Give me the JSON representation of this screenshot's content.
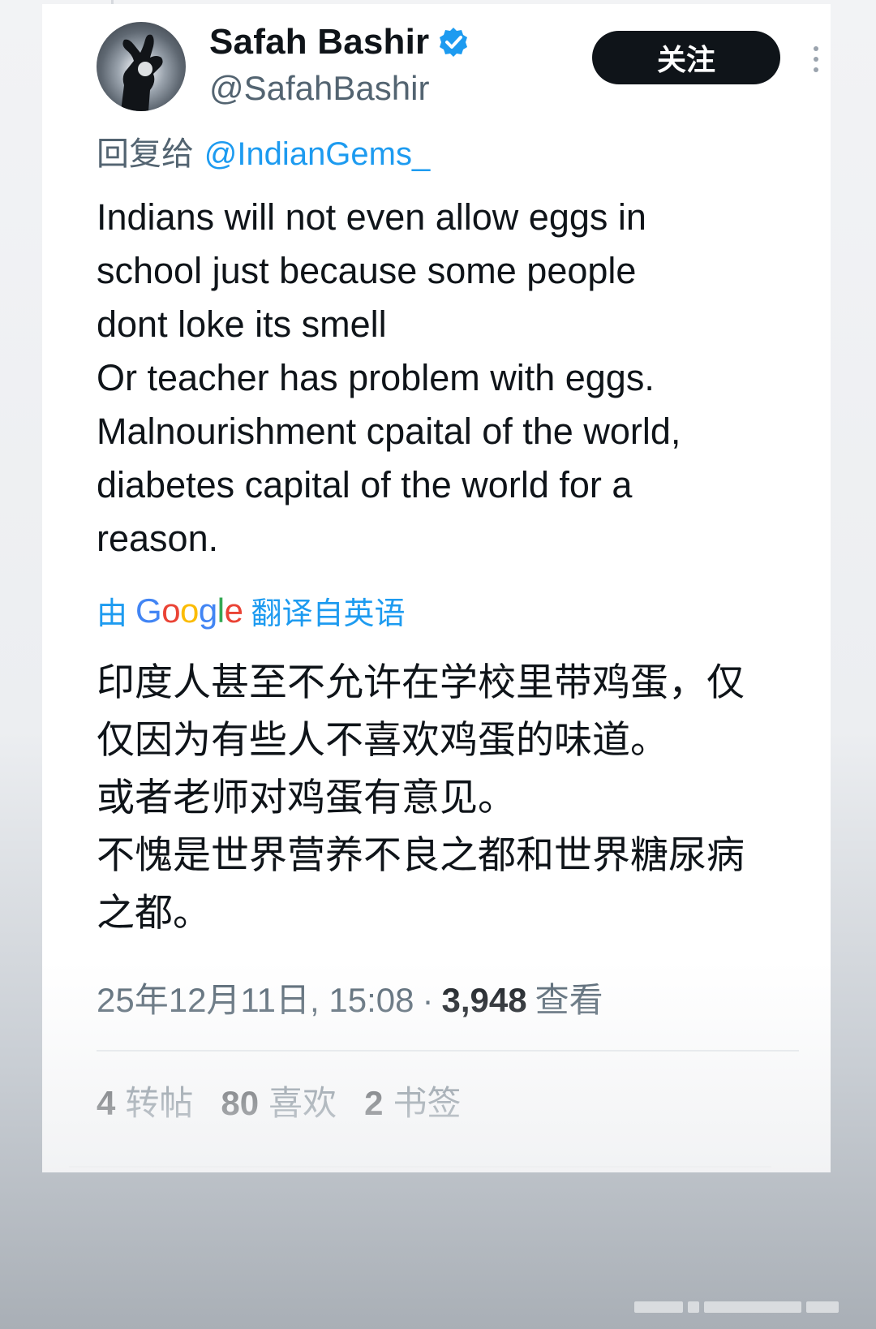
{
  "user": {
    "name": "Safah Bashir",
    "handle": "@SafahBashir",
    "verified": true
  },
  "header": {
    "follow_label": "关注",
    "more_icon": "more-vertical-icon"
  },
  "reply": {
    "prefix": "回复给",
    "mention": "@IndianGems_"
  },
  "tweet": {
    "text_en": "Indians will not even allow eggs in\nschool just because some people\ndont loke its smell\nOr teacher has problem with eggs.\nMalnourishment cpaital of the world,\ndiabetes capital of the world for a\nreason.",
    "translate_prefix": "由",
    "translate_brand": "Google",
    "translate_suffix": "翻译自英语",
    "text_zh": "印度人甚至不允许在学校里带鸡蛋，仅\n仅因为有些人不喜欢鸡蛋的味道。\n或者老师对鸡蛋有意见。\n不愧是世界营养不良之都和世界糖尿病\n之都。"
  },
  "meta": {
    "timestamp": "25年12月11日, 15:08",
    "separator": "·",
    "views_count": "3,948",
    "views_label": "查看"
  },
  "stats": {
    "reposts_count": "4",
    "reposts_label": "转帖",
    "likes_count": "80",
    "likes_label": "喜欢",
    "bookmarks_count": "2",
    "bookmarks_label": "书签"
  },
  "colors": {
    "accent": "#1d9bf0",
    "text_primary": "#0f1419",
    "text_secondary": "#536471",
    "button_bg": "#0f1419"
  }
}
